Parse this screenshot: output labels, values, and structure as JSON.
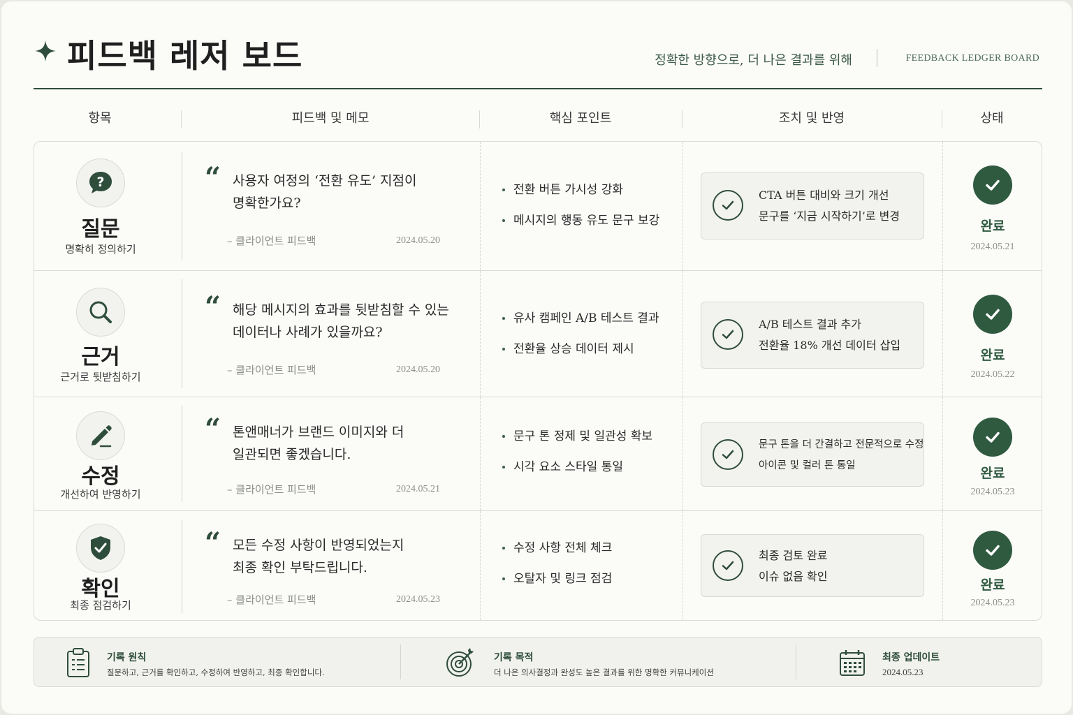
{
  "header": {
    "title": "피드백 레저 보드",
    "tagline": "정확한 방향으로, 더 나은 결과를 위해",
    "english_title": "FEEDBACK LEDGER BOARD"
  },
  "columns": [
    "항목",
    "피드백 및 메모",
    "핵심 포인트",
    "조치 및 반영",
    "상태"
  ],
  "rows": [
    {
      "icon": "question-icon",
      "category": "질문",
      "category_sub": "명확히 정의하기",
      "feedback_lines": [
        "사용자 여정의 ‘전환 유도’ 지점이",
        "명확한가요?"
      ],
      "source": "– 클라이언트 피드백",
      "feedback_date": "2024.05.20",
      "key_points": [
        "전환 버튼 가시성 강화",
        "메시지의 행동 유도 문구 보강"
      ],
      "actions": [
        "CTA 버튼 대비와 크기 개선",
        "문구를 ‘지금 시작하기’로 변경"
      ],
      "status": "완료",
      "status_date": "2024.05.21"
    },
    {
      "icon": "search-icon",
      "category": "근거",
      "category_sub": "근거로 뒷받침하기",
      "feedback_lines": [
        "해당 메시지의 효과를 뒷받침할 수 있는",
        "데이터나 사례가 있을까요?"
      ],
      "source": "– 클라이언트 피드백",
      "feedback_date": "2024.05.20",
      "key_points": [
        "유사 캠페인 A/B 테스트 결과",
        "전환율 상승 데이터 제시"
      ],
      "actions": [
        "A/B 테스트 결과 추가",
        "전환율 18% 개선 데이터 삽입"
      ],
      "status": "완료",
      "status_date": "2024.05.22"
    },
    {
      "icon": "pencil-icon",
      "category": "수정",
      "category_sub": "개선하여 반영하기",
      "feedback_lines": [
        "톤앤매너가 브랜드 이미지와 더",
        "일관되면 좋겠습니다."
      ],
      "source": "– 클라이언트 피드백",
      "feedback_date": "2024.05.21",
      "key_points": [
        "문구 톤 정제 및 일관성 확보",
        "시각 요소 스타일 통일"
      ],
      "actions": [
        "문구 톤을 더 간결하고 전문적으로 수정",
        "아이콘 및 컬러 톤 통일"
      ],
      "status": "완료",
      "status_date": "2024.05.23"
    },
    {
      "icon": "shield-check-icon",
      "category": "확인",
      "category_sub": "최종 점검하기",
      "feedback_lines": [
        "모든 수정 사항이 반영되었는지",
        "최종 확인 부탁드립니다."
      ],
      "source": "– 클라이언트 피드백",
      "feedback_date": "2024.05.23",
      "key_points": [
        "수정 사항 전체 체크",
        "오탈자 및 링크 점검"
      ],
      "actions": [
        "최종 검토 완료",
        "이슈 없음 확인"
      ],
      "status": "완료",
      "status_date": "2024.05.23"
    }
  ],
  "footer": [
    {
      "icon": "clipboard-icon",
      "title": "기록 원칙",
      "text": "질문하고, 근거를 확인하고, 수정하여 반영하고, 최종 확인합니다."
    },
    {
      "icon": "target-icon",
      "title": "기록 목적",
      "text": "더 나은 의사결정과 완성도 높은 결과를 위한 명확한 커뮤니케이션"
    },
    {
      "icon": "calendar-icon",
      "title": "최종 업데이트",
      "text": "2024.05.23"
    }
  ],
  "colors": {
    "accent": "#2f4d3b",
    "status": "#2f5a40",
    "background": "#fbfbf8"
  }
}
